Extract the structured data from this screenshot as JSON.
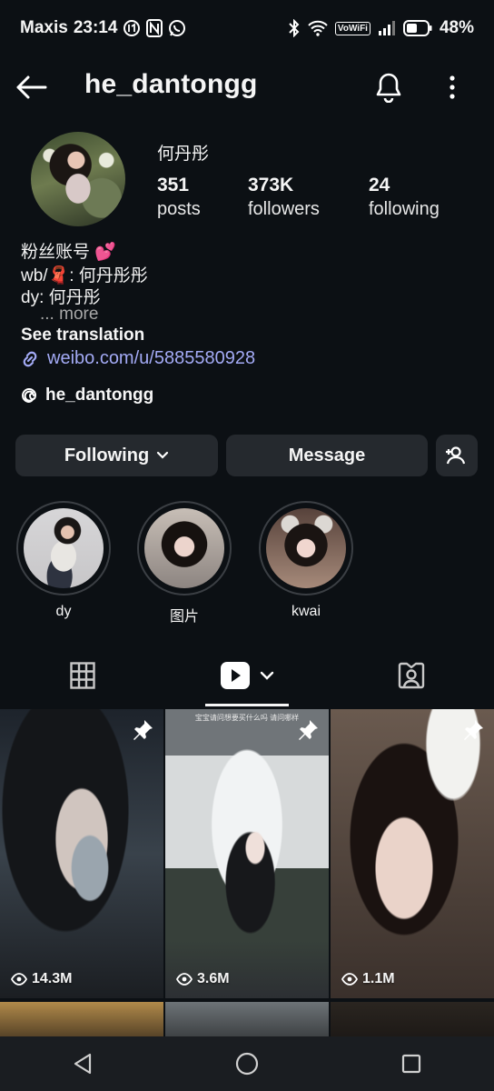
{
  "status_bar": {
    "carrier": "Maxis",
    "time": "23:14",
    "volte": "VoWiFi",
    "battery": "48%"
  },
  "header": {
    "username": "he_dantongg"
  },
  "profile": {
    "display_name": "何丹彤",
    "stats": {
      "posts": {
        "value": "351",
        "label": "posts"
      },
      "followers": {
        "value": "373K",
        "label": "followers"
      },
      "following": {
        "value": "24",
        "label": "following"
      }
    },
    "bio_line1": "粉丝账号 💕",
    "bio_line2": "wb/🧣: 何丹彤彤",
    "bio_line3": "dy: 何丹彤",
    "bio_more": "... more",
    "see_translation": "See translation",
    "link": "weibo.com/u/5885580928",
    "threads_handle": "he_dantongg"
  },
  "actions": {
    "following_label": "Following",
    "message_label": "Message"
  },
  "highlights": [
    {
      "label": "dy"
    },
    {
      "label": "图片"
    },
    {
      "label": "kwai"
    }
  ],
  "tabs": {
    "active": "reels"
  },
  "grid": [
    {
      "views": "14.3M",
      "pinned": true
    },
    {
      "views": "3.6M",
      "pinned": true
    },
    {
      "views": "1.1M",
      "pinned": true
    }
  ],
  "cell1_caption": "宝宝请问想要买什么吗 请问哪样"
}
